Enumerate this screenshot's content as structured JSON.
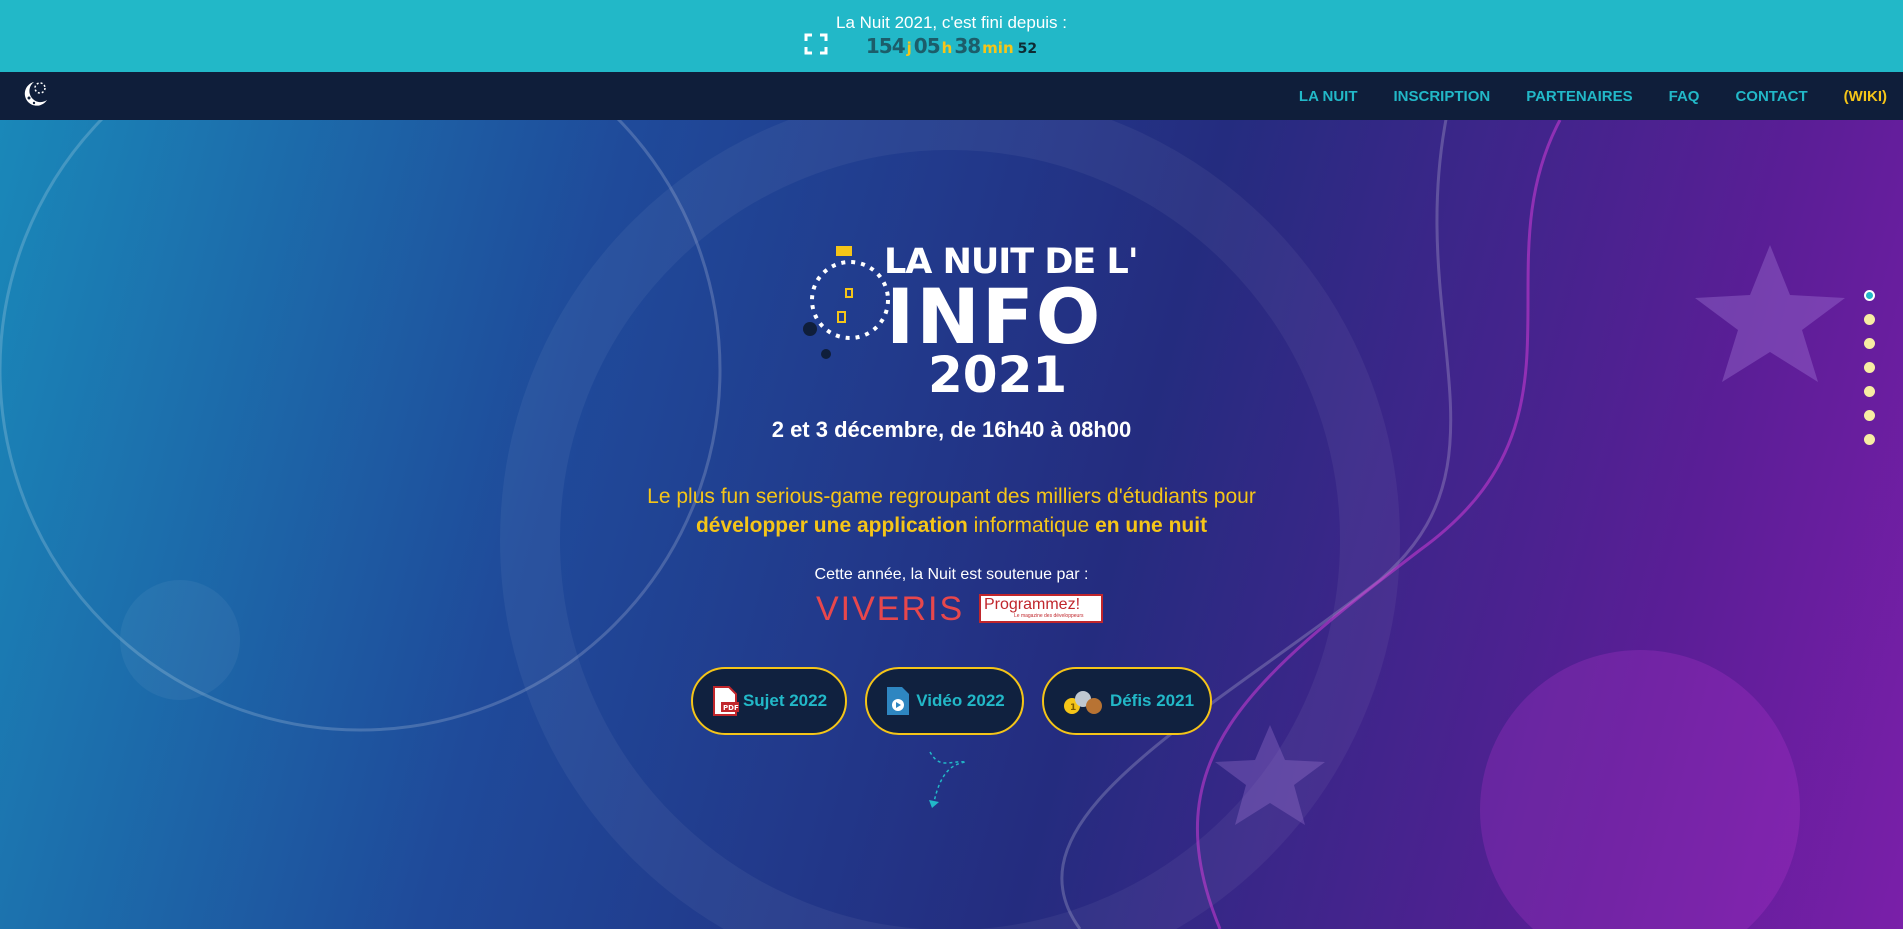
{
  "banner": {
    "title": "La Nuit 2021, c'est fini depuis :",
    "days": "154",
    "days_unit": "j",
    "hours": "05",
    "hours_unit": "h",
    "minutes": "38",
    "minutes_unit": "min",
    "seconds": "52",
    "fullscreen_icon": "fullscreen-icon"
  },
  "nav": {
    "logo_icon": "moon-logo-icon",
    "items": [
      {
        "label": "LA NUIT"
      },
      {
        "label": "INSCRIPTION"
      },
      {
        "label": "PARTENAIRES"
      },
      {
        "label": "FAQ"
      },
      {
        "label": "CONTACT"
      },
      {
        "label": "(WIKI)"
      }
    ]
  },
  "hero": {
    "logo_line1": "LA NUIT DE L'",
    "logo_line2": "INFO",
    "logo_line3": "2021",
    "dates": "2 et 3 décembre, de 16h40 à 08h00",
    "tagline_part1": "Le plus fun serious-game regroupant des milliers d'étudiants pour",
    "tagline_bold1": "développer une application",
    "tagline_part2": " informatique ",
    "tagline_bold2": "en une nuit",
    "sponsor_label": "Cette année, la Nuit est soutenue par :",
    "sponsors": [
      {
        "name": "VIVERIS"
      },
      {
        "name": "Programmez!",
        "tagline": "Le magazine des développeurs"
      }
    ],
    "buttons": [
      {
        "label": "Sujet 2022",
        "icon": "pdf-icon"
      },
      {
        "label": "Vidéo 2022",
        "icon": "video-icon"
      },
      {
        "label": "Défis 2021",
        "icon": "medals-icon"
      }
    ]
  },
  "section_dots": {
    "count": 7,
    "active_index": 0
  },
  "colors": {
    "banner": "#22b8c8",
    "nav": "#0f1e3a",
    "accent_yellow": "#f5c518",
    "accent_cyan": "#22b8c8"
  }
}
